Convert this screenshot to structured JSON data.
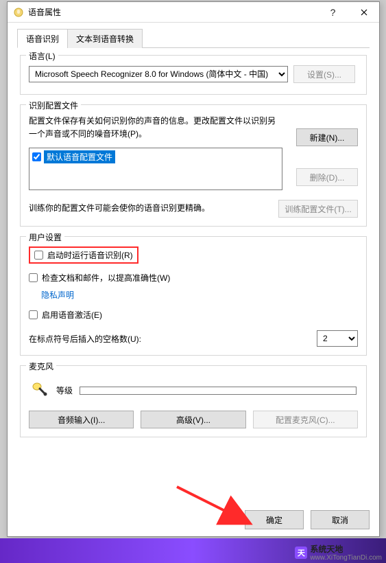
{
  "window": {
    "title": "语音属性"
  },
  "tabs": {
    "active": "语音识别",
    "inactive": "文本到语音转换"
  },
  "lang_group": {
    "title": "语言(L)",
    "selected": "Microsoft Speech Recognizer 8.0 for Windows (简体中文 - 中国)",
    "settings_btn": "设置(S)..."
  },
  "profile_group": {
    "title": "识别配置文件",
    "desc": "配置文件保存有关如何识别你的声音的信息。更改配置文件以识别另一个声音或不同的噪音环境(P)。",
    "new_btn": "新建(N)...",
    "delete_btn": "删除(D)...",
    "list_item": "默认语音配置文件",
    "train_desc": "训练你的配置文件可能会使你的语音识别更精确。",
    "train_btn": "训练配置文件(T)..."
  },
  "user_group": {
    "title": "用户设置",
    "run_at_startup": "启动时运行语音识别(R)",
    "review_docs": "检查文档和邮件，以提高准确性(W)",
    "privacy_link": "隐私声明",
    "enable_activation": "启用语音激活(E)",
    "spaces_label": "在标点符号后插入的空格数(U):",
    "spaces_value": "2"
  },
  "mic_group": {
    "title": "麦克风",
    "level_label": "等级",
    "audio_input_btn": "音频输入(I)...",
    "advanced_btn": "高级(V)...",
    "config_mic_btn": "配置麦克风(C)..."
  },
  "footer": {
    "ok": "确定",
    "cancel": "取消"
  },
  "watermark": {
    "name": "系统天地",
    "url": "www.XiTongTianDi.com"
  }
}
